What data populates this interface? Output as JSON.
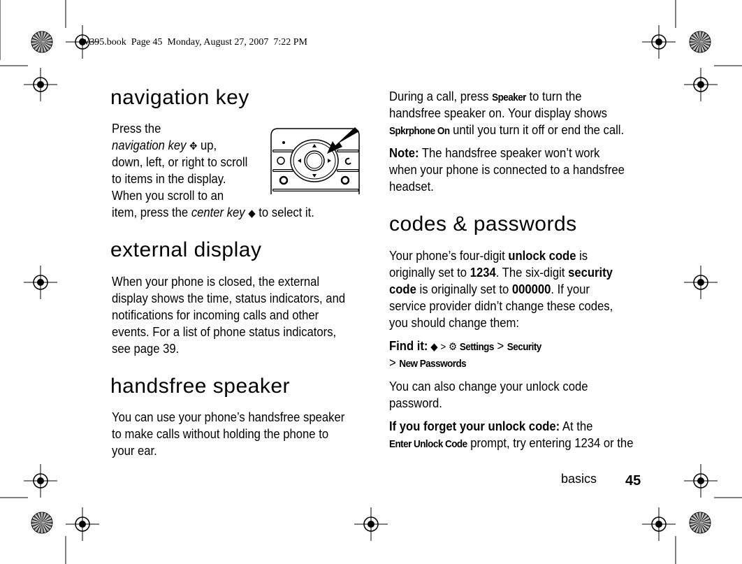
{
  "header": {
    "print_info": "W395.book  Page 45  Monday, August 27, 2007  7:22 PM"
  },
  "left": {
    "sections": [
      {
        "heading": "navigation key",
        "lines": [
          [
            [
              "Press the",
              "n"
            ]
          ],
          [
            [
              "navigation key ",
              "i"
            ],
            [
              "✥",
              "g"
            ],
            [
              " up,",
              "n"
            ]
          ],
          [
            [
              "down, left, or right to scroll",
              "n"
            ]
          ],
          [
            [
              "to items in the display.",
              "n"
            ]
          ],
          [
            [
              "When you scroll to an",
              "n"
            ]
          ],
          [
            [
              "item, press the ",
              "n"
            ],
            [
              "center key ",
              "i"
            ],
            [
              "◆",
              "g"
            ],
            [
              " to select it.",
              "n"
            ]
          ]
        ]
      },
      {
        "heading": "external display",
        "lines": [
          [
            [
              "When your phone is closed, the external",
              "n"
            ]
          ],
          [
            [
              "display shows the time, status indicators, and",
              "n"
            ]
          ],
          [
            [
              "notifications for incoming calls and other",
              "n"
            ]
          ],
          [
            [
              "events. For a list of phone status indicators,",
              "n"
            ]
          ],
          [
            [
              "see page 39.",
              "n"
            ]
          ]
        ]
      },
      {
        "heading": "handsfree speaker",
        "lines": [
          [
            [
              "You can use your phone’s handsfree speaker",
              "n"
            ]
          ],
          [
            [
              "to make calls without holding the phone to",
              "n"
            ]
          ],
          [
            [
              "your ear.",
              "n"
            ]
          ]
        ]
      }
    ]
  },
  "right": {
    "blocks": [
      [
        [
          [
            "During a call, press ",
            "n"
          ],
          [
            "Speaker",
            "d"
          ],
          [
            " to turn the",
            "n"
          ]
        ],
        [
          [
            "handsfree speaker on. Your display shows",
            "n"
          ]
        ],
        [
          [
            "Spkrphone On",
            "d"
          ],
          [
            " until you turn it off or end the call.",
            "n"
          ]
        ]
      ],
      [
        [
          [
            "Note:",
            "b"
          ],
          [
            " The handsfree speaker won’t work",
            "n"
          ]
        ],
        [
          [
            "when your phone is connected to a handsfree",
            "n"
          ]
        ],
        [
          [
            "headset.",
            "n"
          ]
        ]
      ],
      [
        [
          [
            "Your phone’s four-digit ",
            "n"
          ],
          [
            "unlock code",
            "b"
          ],
          [
            " is",
            "n"
          ]
        ],
        [
          [
            "originally set to ",
            "n"
          ],
          [
            "1234",
            "b"
          ],
          [
            ". The six-digit ",
            "n"
          ],
          [
            "security",
            "b"
          ]
        ],
        [
          [
            "code",
            "b"
          ],
          [
            " is originally set to ",
            "n"
          ],
          [
            "000000",
            "b"
          ],
          [
            ". If your",
            "n"
          ]
        ],
        [
          [
            "service provider didn’t change these codes,",
            "n"
          ]
        ],
        [
          [
            "you should change them:",
            "n"
          ]
        ]
      ],
      [
        [
          [
            "Find it:",
            "b"
          ],
          [
            " ◆ > ",
            "g"
          ],
          [
            "⚙ ",
            "g"
          ],
          [
            "Settings",
            "d"
          ],
          [
            " > ",
            "n"
          ],
          [
            "Security",
            "d"
          ]
        ],
        [
          [
            "> ",
            "n"
          ],
          [
            "New Passwords",
            "d"
          ]
        ]
      ],
      [
        [
          [
            "You can also change your unlock code",
            "n"
          ]
        ],
        [
          [
            "password.",
            "n"
          ]
        ]
      ],
      [
        [
          [
            "If you forget your unlock code:",
            "b"
          ],
          [
            " At the",
            "n"
          ]
        ],
        [
          [
            "Enter Unlock Code",
            "d"
          ],
          [
            " prompt, try entering 1234 or the",
            "n"
          ]
        ]
      ]
    ],
    "heading": "codes & passwords"
  },
  "footer": {
    "section": "basics",
    "page": "45"
  },
  "icons": {
    "nav_key": "navigation-key-icon",
    "center_key": "center-key-icon",
    "settings": "settings-icon",
    "illustration": "phone-keypad-navigation-illustration"
  }
}
